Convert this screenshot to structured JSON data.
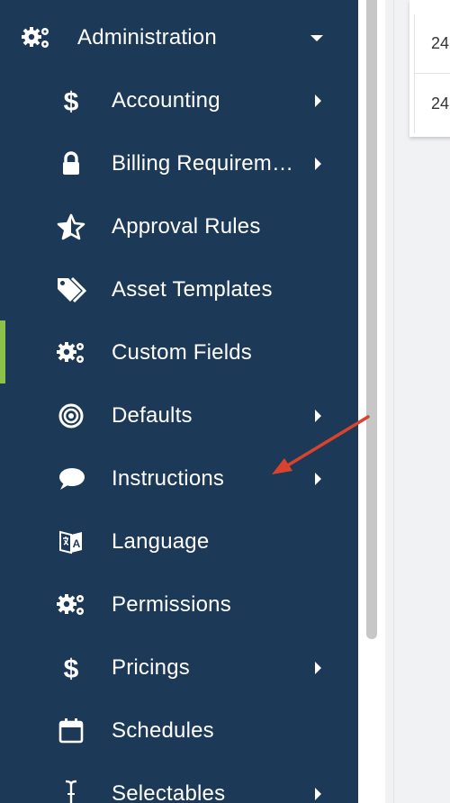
{
  "sidebar": {
    "header": {
      "label": "Administration",
      "icon": "gears-icon",
      "expanded": true
    },
    "items": [
      {
        "label": "Accounting",
        "icon": "dollar-icon",
        "has_submenu": true
      },
      {
        "label": "Billing Requirem…",
        "icon": "lock-icon",
        "has_submenu": true
      },
      {
        "label": "Approval Rules",
        "icon": "star-half-icon",
        "has_submenu": false
      },
      {
        "label": "Asset Templates",
        "icon": "tags-icon",
        "has_submenu": false
      },
      {
        "label": "Custom Fields",
        "icon": "gears-icon",
        "has_submenu": false,
        "active": true
      },
      {
        "label": "Defaults",
        "icon": "bullseye-icon",
        "has_submenu": true
      },
      {
        "label": "Instructions",
        "icon": "comment-icon",
        "has_submenu": true
      },
      {
        "label": "Language",
        "icon": "language-icon",
        "has_submenu": false
      },
      {
        "label": "Permissions",
        "icon": "gears-icon",
        "has_submenu": false
      },
      {
        "label": "Pricings",
        "icon": "dollar-icon",
        "has_submenu": true
      },
      {
        "label": "Schedules",
        "icon": "calendar-icon",
        "has_submenu": false
      },
      {
        "label": "Selectables",
        "icon": "text-cursor-icon",
        "has_submenu": true
      }
    ]
  },
  "table": {
    "cells": [
      "24",
      "24"
    ]
  },
  "colors": {
    "sidebar_bg": "#1c3a57",
    "active_marker": "#8bc34a",
    "annotation_arrow": "#d9432e"
  }
}
